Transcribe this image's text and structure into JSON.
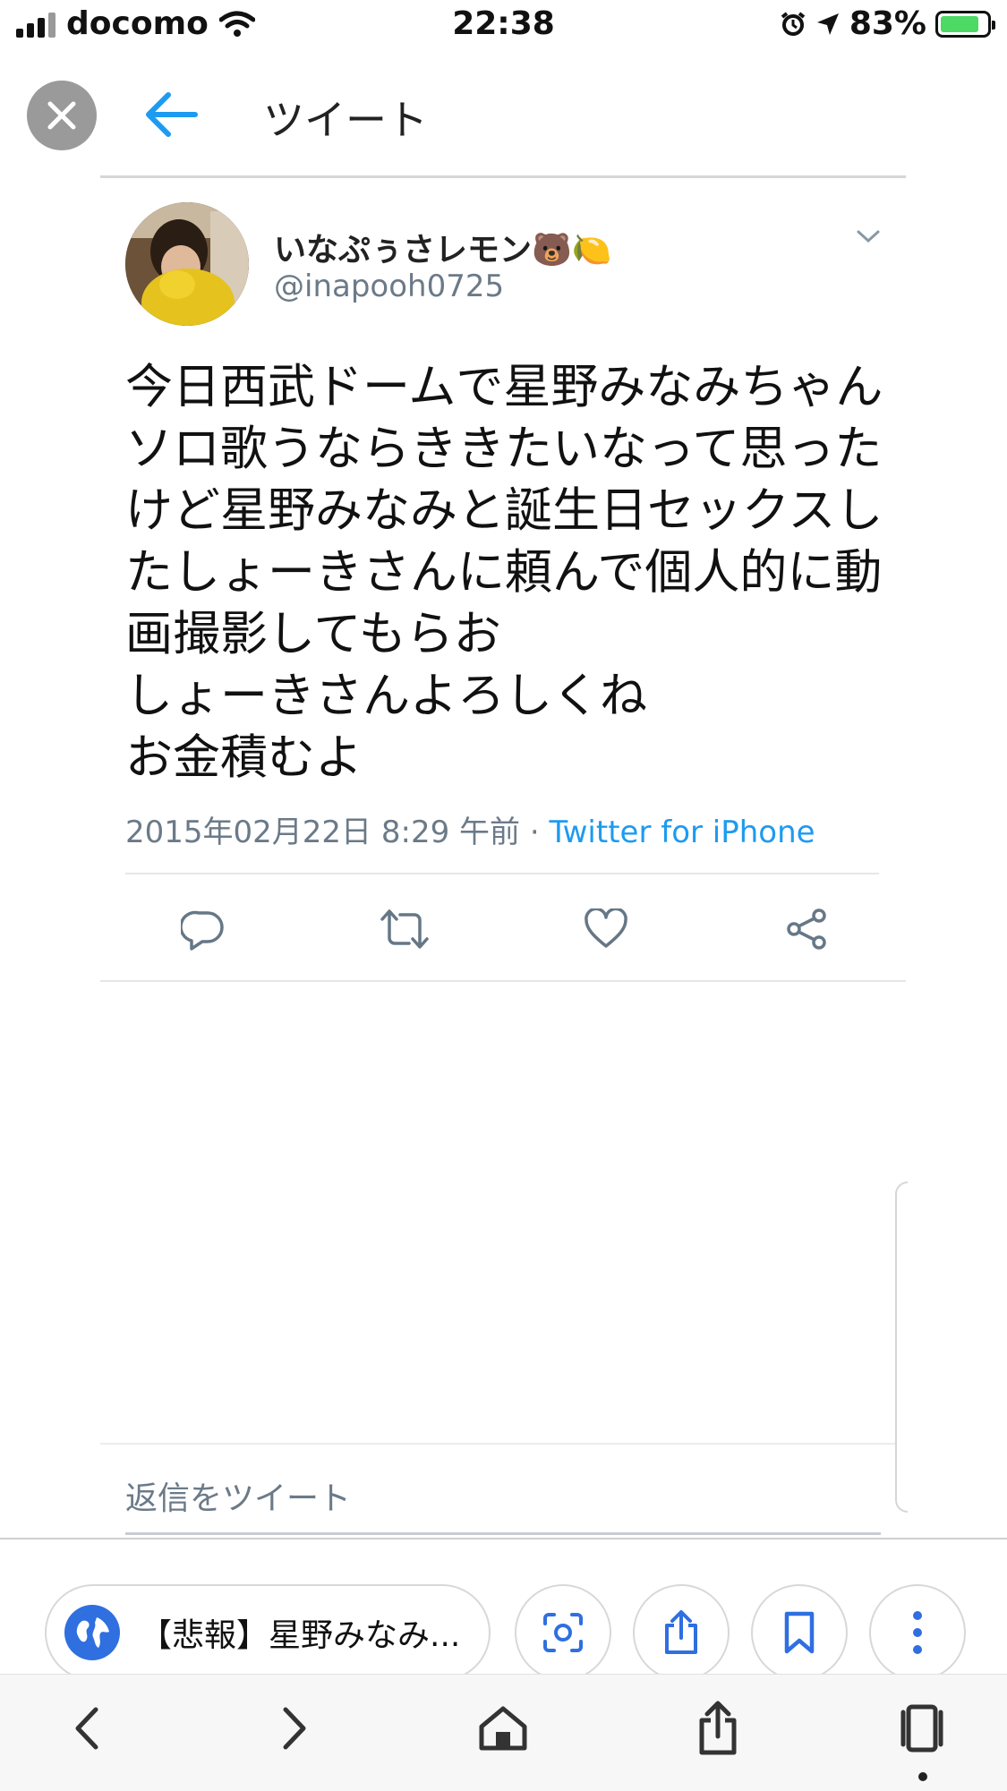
{
  "status_bar": {
    "carrier": "docomo",
    "time": "22:38",
    "battery_percent": "83%",
    "battery_level": 0.83
  },
  "header": {
    "title": "ツイート"
  },
  "tweet": {
    "display_name": "いなぷぅさレモン🐻🍋",
    "handle": "@inapooh0725",
    "text_lines": [
      "今日西武ドームで星野みなみちゃん",
      "ソロ歌うならききたいなって思った",
      "けど星野みなみと誕生日セックスし",
      "たしょーきさんに頼んで個人的に動",
      "画撮影してもらお",
      "しょーきさんよろしくね",
      "お金積むよ"
    ],
    "timestamp": "2015年02月22日 8:29 午前",
    "separator": "·",
    "source": "Twitter for iPhone"
  },
  "reply": {
    "placeholder": "返信をツイート"
  },
  "browser": {
    "url_title": "【悲報】星野みなみ...",
    "accent_color": "#1d9bf0"
  },
  "icons": {
    "close": "close-icon",
    "back": "back-arrow-icon",
    "caret": "chevron-down-icon",
    "reply": "reply-icon",
    "retweet": "retweet-icon",
    "like": "heart-icon",
    "share": "share-icon",
    "globe": "globe-icon",
    "lens": "lens-icon",
    "bookmark": "bookmark-icon",
    "more": "more-vertical-icon",
    "nav_back": "chevron-left-icon",
    "nav_forward": "chevron-right-icon",
    "home": "home-icon",
    "tabs": "tabs-icon"
  }
}
